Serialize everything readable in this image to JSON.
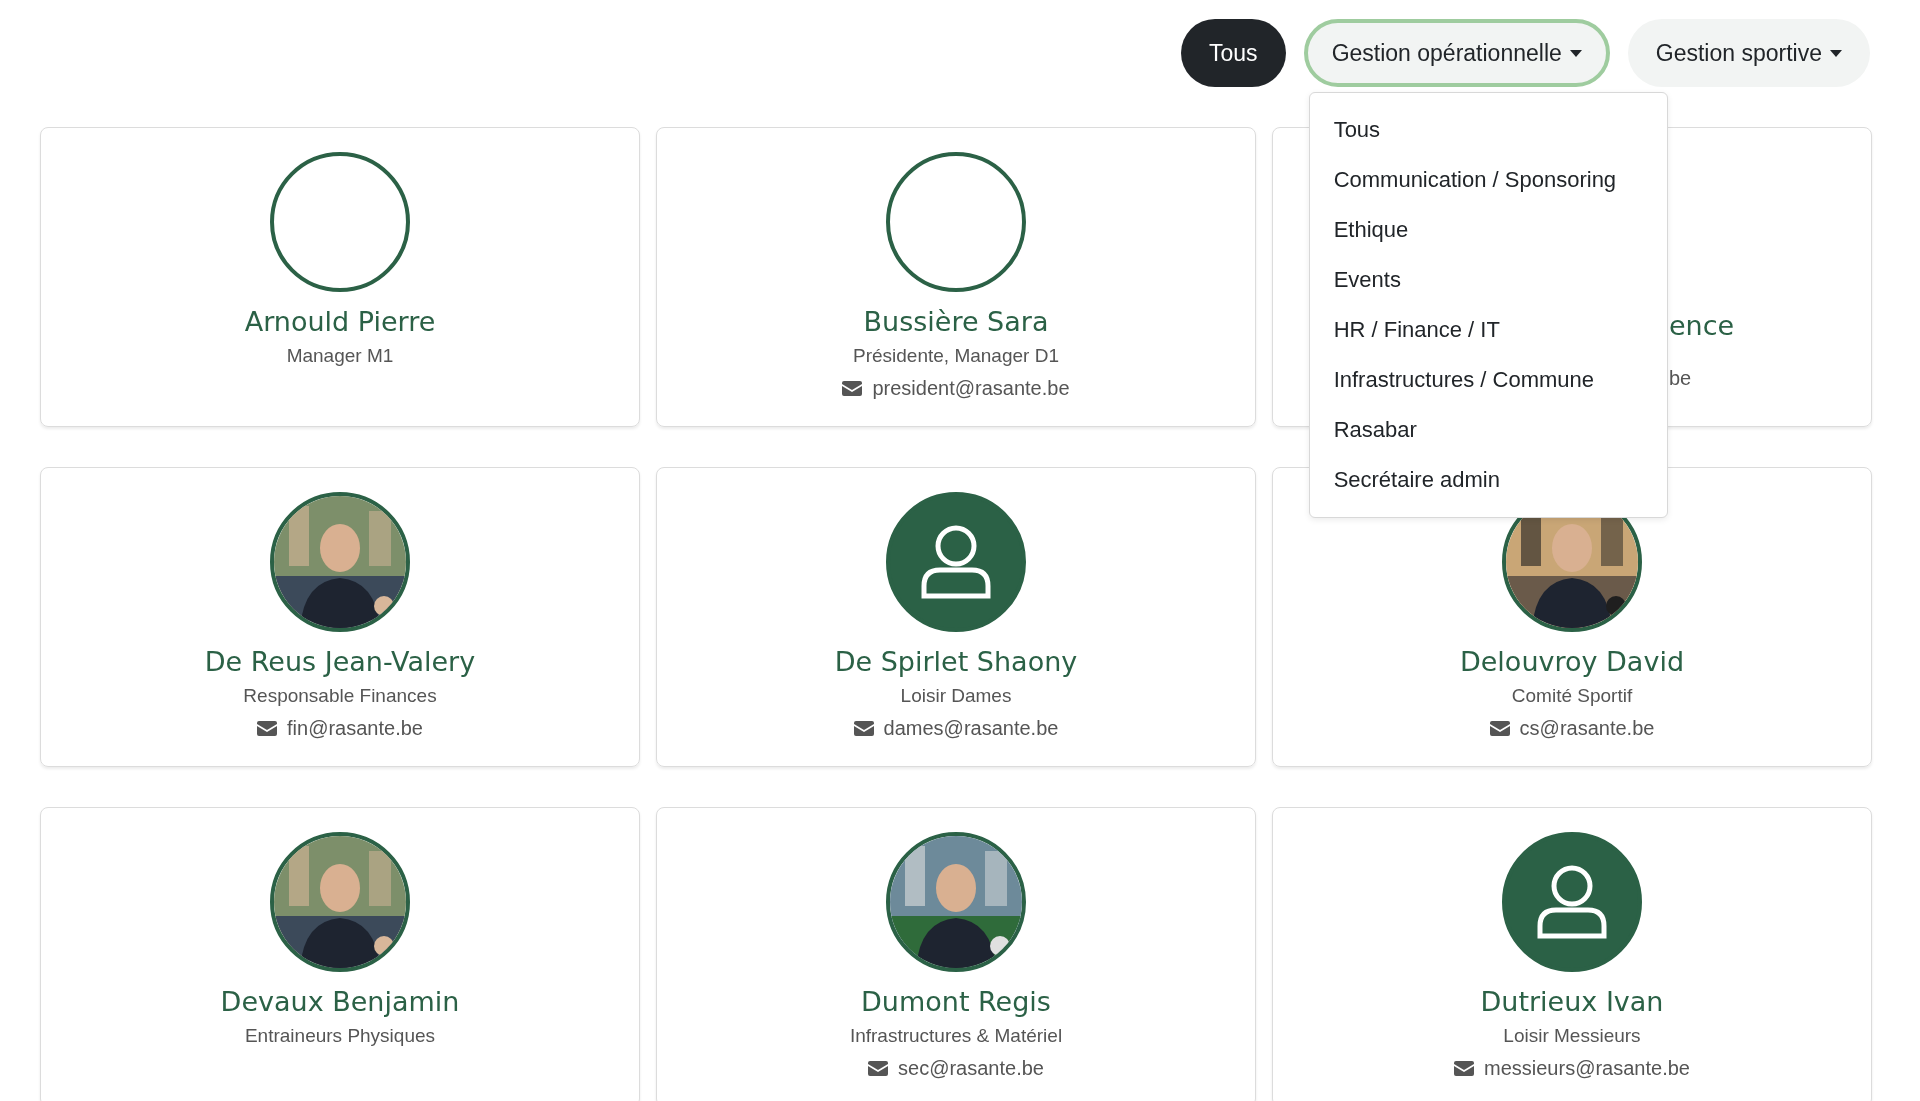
{
  "filters": [
    {
      "label": "Tous",
      "selected": true,
      "dropdown": false,
      "expanded": false
    },
    {
      "label": "Gestion opérationnelle",
      "selected": false,
      "dropdown": true,
      "expanded": true
    },
    {
      "label": "Gestion sportive",
      "selected": false,
      "dropdown": true,
      "expanded": false
    }
  ],
  "dropdown_menu": {
    "items": [
      "Tous",
      "Communication / Sponsoring",
      "Ethique",
      "Events",
      "HR / Finance / IT",
      "Infrastructures / Commune",
      "Rasabar",
      "Secrétaire admin"
    ]
  },
  "members": [
    {
      "kind": "full",
      "avatar": {
        "kind": "broken"
      },
      "name": "Arnould Pierre",
      "role": "Manager M1"
    },
    {
      "kind": "full",
      "avatar": {
        "kind": "broken"
      },
      "name": "Bussière Sara",
      "role": "Présidente, Manager D1",
      "email": "president@rasante.be"
    },
    {
      "kind": "covered",
      "name": "ence",
      "email": "be"
    },
    {
      "kind": "full",
      "name": "De Reus Jean-Valery",
      "role": "Responsable Finances",
      "email": "fin@rasante.be"
    },
    {
      "kind": "full",
      "avatar": {
        "kind": "placeholder"
      },
      "name": "De Spirlet Shaony",
      "role": "Loisir Dames",
      "email": "dames@rasante.be"
    },
    {
      "kind": "full",
      "name": "Delouvroy David",
      "role": "Comité Sportif",
      "email": "cs@rasante.be"
    },
    {
      "kind": "full",
      "name": "Devaux Benjamin",
      "role": "Entraineurs Physiques"
    },
    {
      "kind": "full",
      "name": "Dumont Regis",
      "role": "Infrastructures & Matériel",
      "email": "sec@rasante.be"
    },
    {
      "kind": "full",
      "avatar": {
        "kind": "placeholder"
      },
      "name": "Dutrieux Ivan",
      "role": "Loisir Messieurs",
      "email": "messieurs@rasante.be"
    }
  ]
}
